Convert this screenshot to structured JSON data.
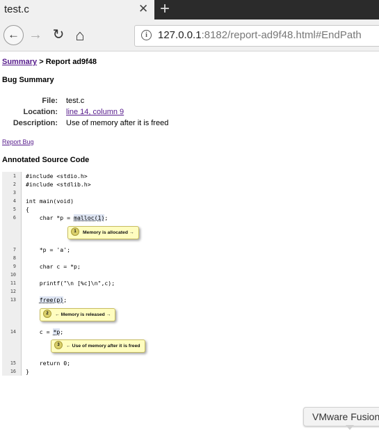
{
  "browser": {
    "tab_title": "test.c",
    "tab_close": "✕",
    "new_tab": "+",
    "back": "←",
    "forward": "→",
    "reload": "↻",
    "home": "⌂",
    "info": "i",
    "url_host": "127.0.0.1",
    "url_rest": ":8182/report-ad9f48.html#EndPath"
  },
  "breadcrumb": {
    "link": "Summary",
    "sep": " > ",
    "current": "Report ad9f48"
  },
  "bug_summary": {
    "heading": "Bug Summary",
    "file_label": "File:",
    "file_value": "test.c",
    "location_label": "Location:",
    "location_value": "line 14, column 9",
    "description_label": "Description:",
    "description_value": "Use of memory after it is freed"
  },
  "report_bug": "Report Bug",
  "annotated_heading": "Annotated Source Code",
  "code_lines": [
    {
      "n": "1",
      "pre": "#include <stdio.h>"
    },
    {
      "n": "2",
      "pre": "#include <stdlib.h>"
    },
    {
      "n": "3",
      "pre": ""
    },
    {
      "n": "4",
      "pre": "int main(void)"
    },
    {
      "n": "5",
      "pre": "{"
    },
    {
      "n": "6",
      "pre": "    char *p = ",
      "mark": "malloc(1)",
      "post": ";"
    },
    {
      "n": "7",
      "pre": "    *p = 'a';"
    },
    {
      "n": "8",
      "pre": ""
    },
    {
      "n": "9",
      "pre": "    char c = *p;"
    },
    {
      "n": "10",
      "pre": ""
    },
    {
      "n": "11",
      "pre": "    printf(\"\\n [%c]\\n\",c);"
    },
    {
      "n": "12",
      "pre": ""
    },
    {
      "n": "13",
      "pre": "    ",
      "mark": "free(p)",
      "post": ";"
    },
    {
      "n": "14",
      "pre": "    c = ",
      "mark": "*p",
      "post": ";"
    },
    {
      "n": "15",
      "pre": "    return 0;"
    },
    {
      "n": "16",
      "pre": "}"
    }
  ],
  "events": [
    {
      "num": "1",
      "text": "Memory is allocated →"
    },
    {
      "num": "2",
      "text": "← Memory is released →"
    },
    {
      "num": "3",
      "text": "← Use of memory after it is freed"
    }
  ],
  "vmware_label": "VMware Fusion",
  "colors": {
    "link": "#551a8b",
    "bubble": "#fffdc0",
    "mark": "#dde4f2"
  }
}
